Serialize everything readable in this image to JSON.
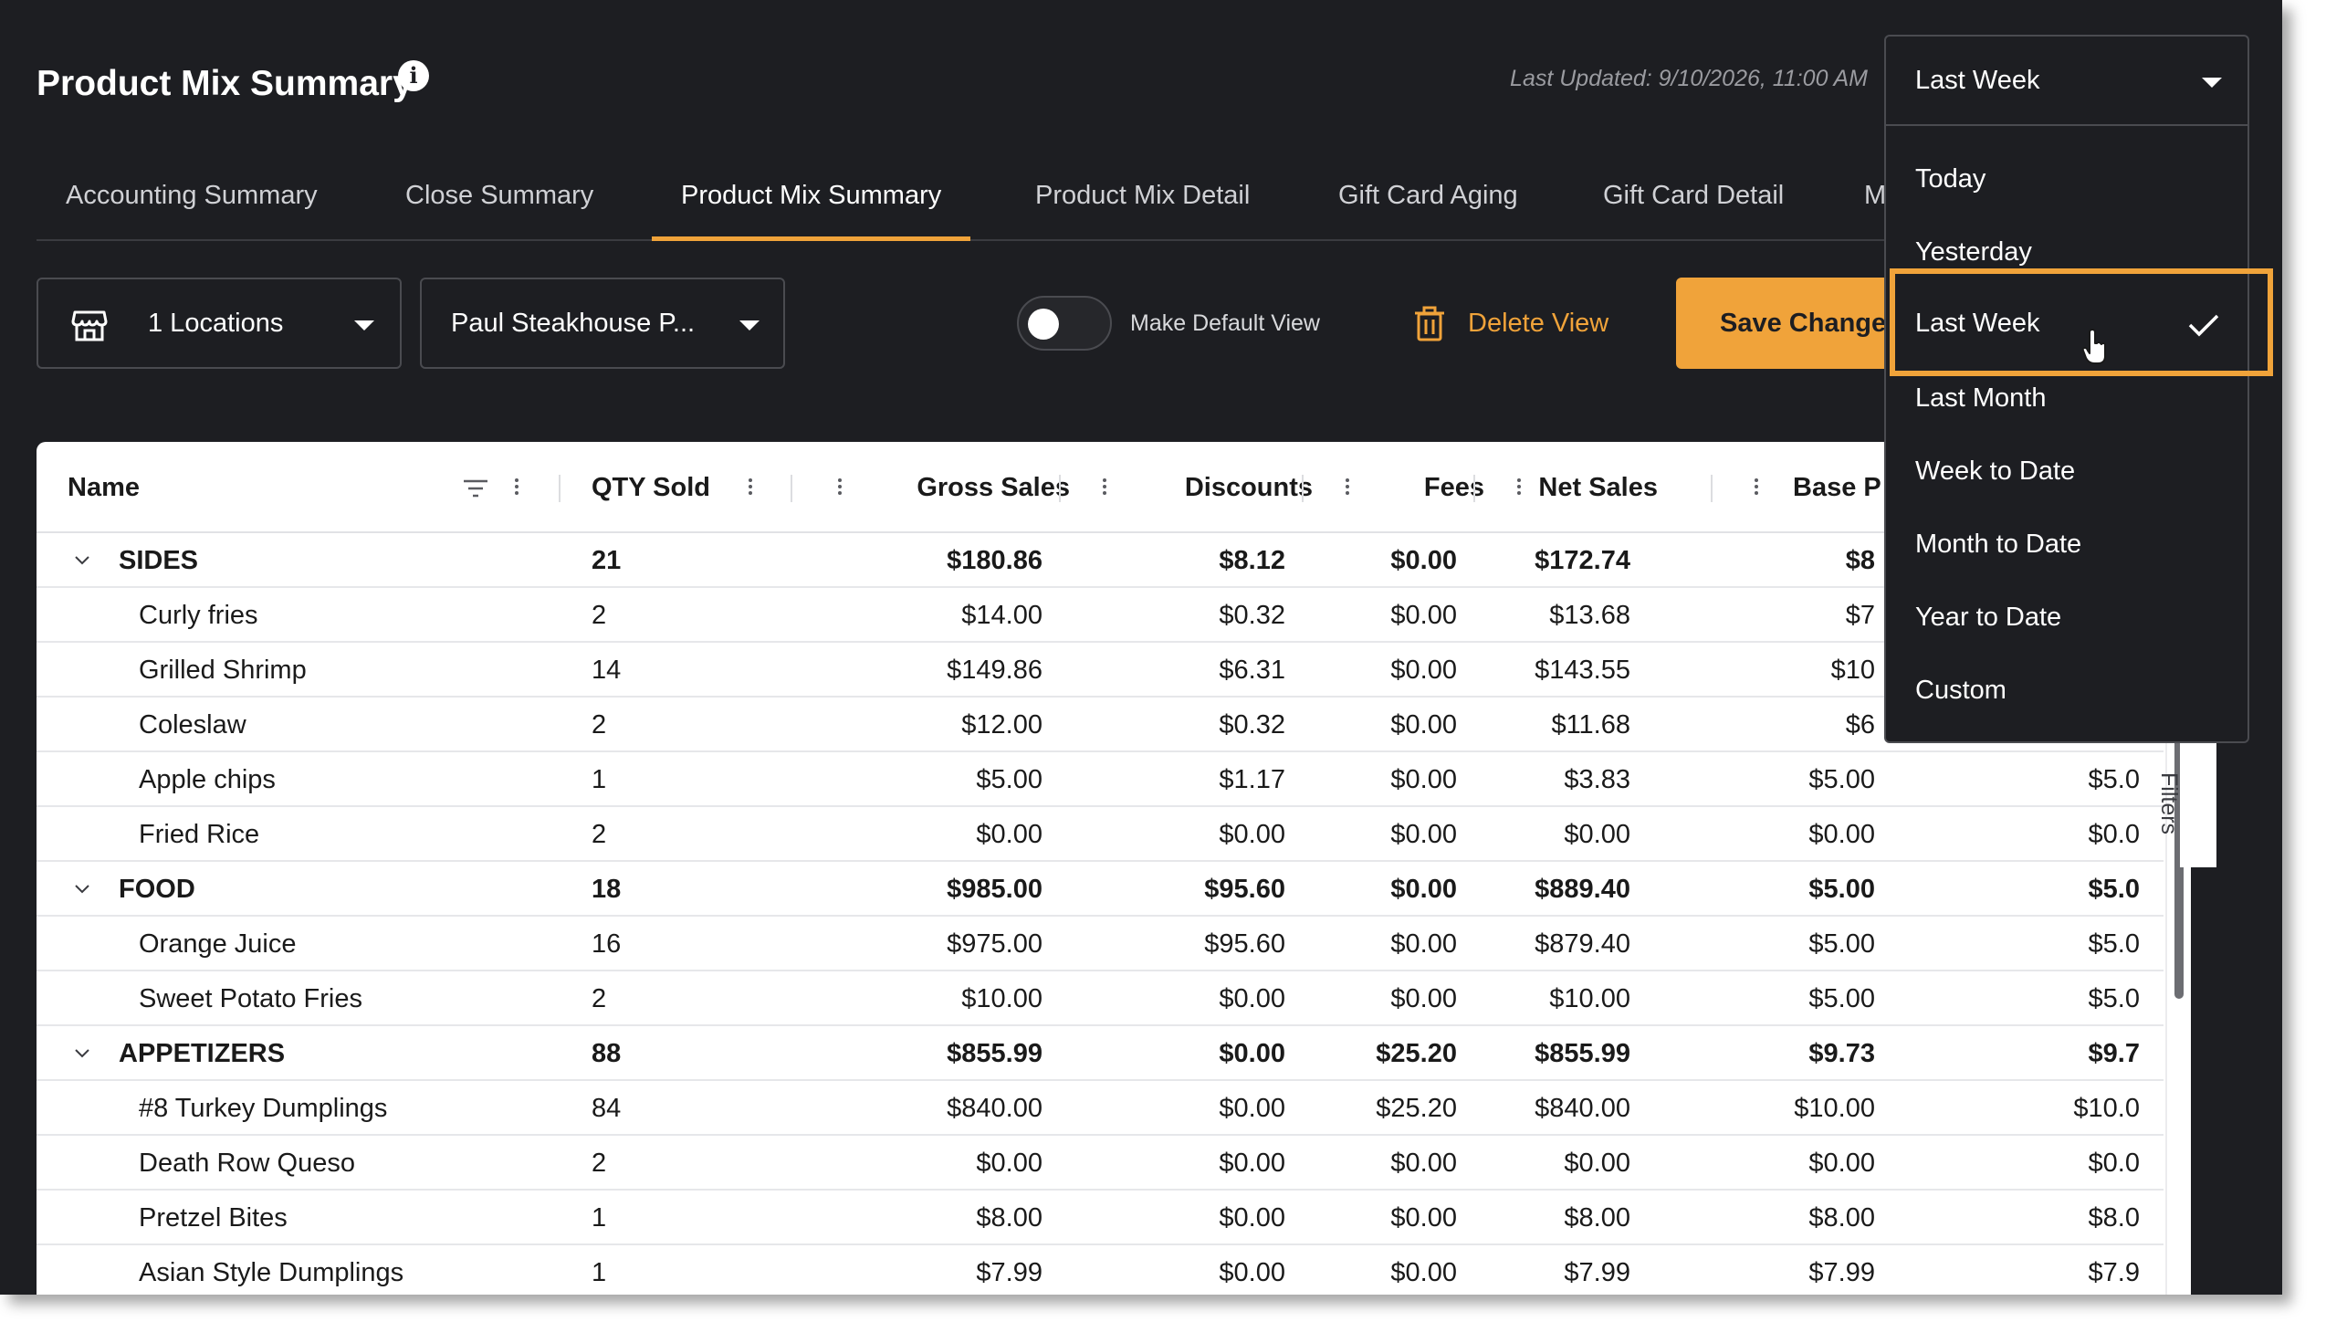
{
  "header": {
    "title": "Product Mix Summary",
    "last_updated": "Last Updated: 9/10/2026, 11:00 AM",
    "info_icon": "info-icon"
  },
  "tabs": [
    {
      "label": "Accounting Summary"
    },
    {
      "label": "Close Summary"
    },
    {
      "label": "Product Mix Summary",
      "active": true
    },
    {
      "label": "Product Mix Detail"
    },
    {
      "label": "Gift Card Aging"
    },
    {
      "label": "Gift Card Detail"
    },
    {
      "label": "M"
    }
  ],
  "toolbar": {
    "locations_label": "1 Locations",
    "store_label": "Paul Steakhouse P...",
    "default_view_label": "Make Default View",
    "default_view_on": false,
    "delete_label": "Delete View",
    "save_label": "Save Change"
  },
  "date_range": {
    "selected": "Last Week",
    "options": [
      "Today",
      "Yesterday",
      "Last Week",
      "Last Month",
      "Week to Date",
      "Month to Date",
      "Year to Date",
      "Custom"
    ]
  },
  "table": {
    "columns": [
      "Name",
      "QTY Sold",
      "Gross Sales",
      "Discounts",
      "Fees",
      "Net Sales",
      "Base P"
    ],
    "rows": [
      {
        "type": "group",
        "name": "SIDES",
        "qty": "21",
        "gross": "$180.86",
        "disc": "$8.12",
        "fees": "$0.00",
        "net": "$172.74",
        "base": "$8",
        "last": ""
      },
      {
        "type": "item",
        "name": "Curly fries",
        "qty": "2",
        "gross": "$14.00",
        "disc": "$0.32",
        "fees": "$0.00",
        "net": "$13.68",
        "base": "$7",
        "last": ""
      },
      {
        "type": "item",
        "name": "Grilled Shrimp",
        "qty": "14",
        "gross": "$149.86",
        "disc": "$6.31",
        "fees": "$0.00",
        "net": "$143.55",
        "base": "$10",
        "last": ""
      },
      {
        "type": "item",
        "name": "Coleslaw",
        "qty": "2",
        "gross": "$12.00",
        "disc": "$0.32",
        "fees": "$0.00",
        "net": "$11.68",
        "base": "$6",
        "last": ""
      },
      {
        "type": "item",
        "name": "Apple chips",
        "qty": "1",
        "gross": "$5.00",
        "disc": "$1.17",
        "fees": "$0.00",
        "net": "$3.83",
        "base": "$5.00",
        "last": "$5.0"
      },
      {
        "type": "item",
        "name": "Fried Rice",
        "qty": "2",
        "gross": "$0.00",
        "disc": "$0.00",
        "fees": "$0.00",
        "net": "$0.00",
        "base": "$0.00",
        "last": "$0.0"
      },
      {
        "type": "group",
        "name": "FOOD",
        "qty": "18",
        "gross": "$985.00",
        "disc": "$95.60",
        "fees": "$0.00",
        "net": "$889.40",
        "base": "$5.00",
        "last": "$5.0"
      },
      {
        "type": "item",
        "name": "Orange Juice",
        "qty": "16",
        "gross": "$975.00",
        "disc": "$95.60",
        "fees": "$0.00",
        "net": "$879.40",
        "base": "$5.00",
        "last": "$5.0"
      },
      {
        "type": "item",
        "name": "Sweet Potato Fries",
        "qty": "2",
        "gross": "$10.00",
        "disc": "$0.00",
        "fees": "$0.00",
        "net": "$10.00",
        "base": "$5.00",
        "last": "$5.0"
      },
      {
        "type": "group",
        "name": "APPETIZERS",
        "qty": "88",
        "gross": "$855.99",
        "disc": "$0.00",
        "fees": "$25.20",
        "net": "$855.99",
        "base": "$9.73",
        "last": "$9.7"
      },
      {
        "type": "item",
        "name": "#8 Turkey Dumplings",
        "qty": "84",
        "gross": "$840.00",
        "disc": "$0.00",
        "fees": "$25.20",
        "net": "$840.00",
        "base": "$10.00",
        "last": "$10.0"
      },
      {
        "type": "item",
        "name": "Death Row Queso",
        "qty": "2",
        "gross": "$0.00",
        "disc": "$0.00",
        "fees": "$0.00",
        "net": "$0.00",
        "base": "$0.00",
        "last": "$0.0"
      },
      {
        "type": "item",
        "name": "Pretzel Bites",
        "qty": "1",
        "gross": "$8.00",
        "disc": "$0.00",
        "fees": "$0.00",
        "net": "$8.00",
        "base": "$8.00",
        "last": "$8.0"
      },
      {
        "type": "item",
        "name": "Asian Style Dumplings",
        "qty": "1",
        "gross": "$7.99",
        "disc": "$0.00",
        "fees": "$0.00",
        "net": "$7.99",
        "base": "$7.99",
        "last": "$7.9"
      }
    ]
  },
  "side_panel": {
    "filters_label": "Filters"
  },
  "colors": {
    "accent": "#f0a33a",
    "background": "#1d1e22",
    "table_bg": "#ffffff"
  }
}
